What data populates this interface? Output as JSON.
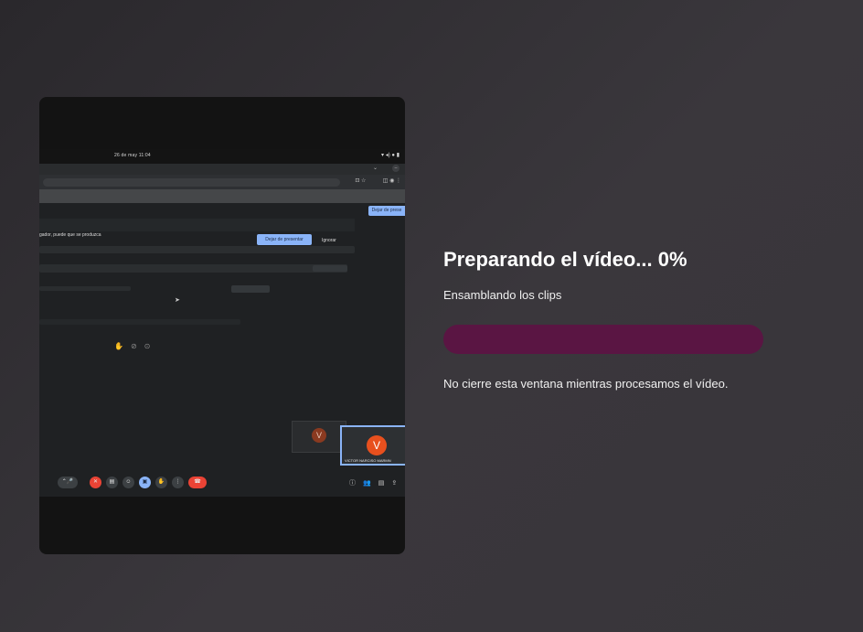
{
  "processing": {
    "title": "Preparando el vídeo... 0%",
    "progress_percent": 0,
    "step": "Ensamblando los clips",
    "notice": "No cierre esta ventana mientras procesamos el vídeo.",
    "accent_color": "#5a1543"
  },
  "preview": {
    "clock": "26 de may  11:04",
    "top_right_button": "Dejar de prese",
    "dialog_text": "gador, puede que se produzca",
    "dialog_button": "Dejar de presentar",
    "dialog_ignore": "Ignorar",
    "participant_initial": "V",
    "participant_name": "VICTOR NARCISO MARMN"
  }
}
